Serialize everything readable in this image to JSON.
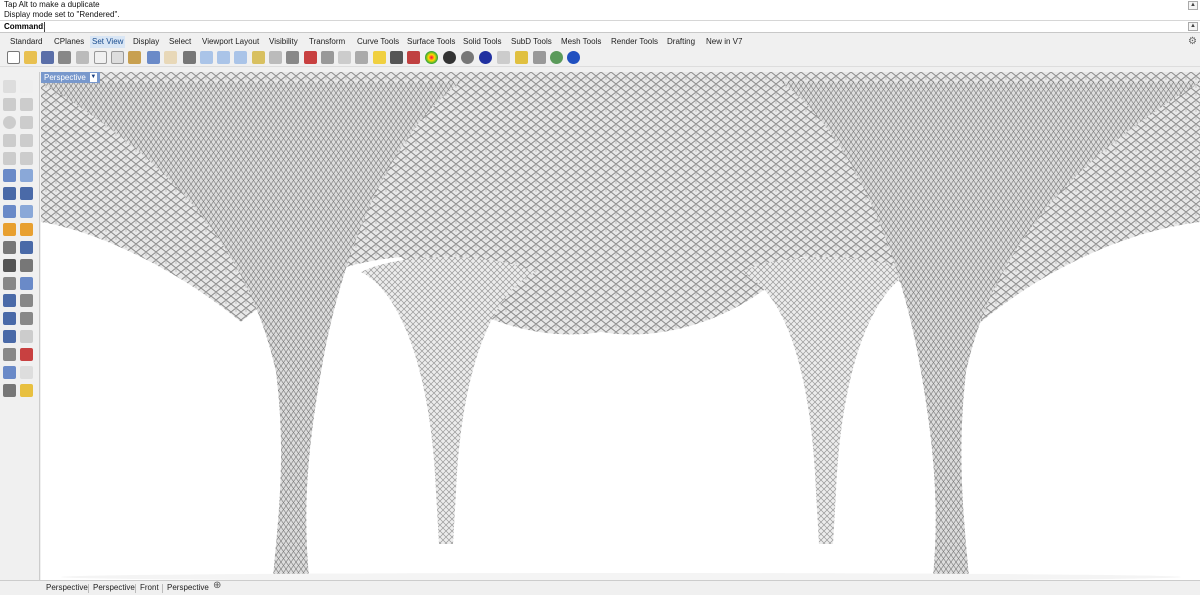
{
  "command": {
    "history": [
      "Tap Alt to make a duplicate",
      "Display mode set to \"Rendered\"."
    ],
    "prompt_label": "Command:",
    "input_value": ""
  },
  "tabs": [
    "Standard",
    "CPlanes",
    "Set View",
    "Display",
    "Select",
    "Viewport Layout",
    "Visibility",
    "Transform",
    "Curve Tools",
    "Surface Tools",
    "Solid Tools",
    "SubD Tools",
    "Mesh Tools",
    "Render Tools",
    "Drafting",
    "New in V7"
  ],
  "active_tab": "Set View",
  "viewport": {
    "label": "Perspective",
    "display_mode": "Rendered"
  },
  "bottom_tabs": [
    "Perspective",
    "Perspective",
    "Front",
    "Perspective"
  ],
  "colors": {
    "accent": "#7898cc",
    "active_tab_bg": "#d9e6f5",
    "background": "#f0f0f0",
    "viewport_bg": "#ffffff"
  },
  "icons": {
    "settings": "gear-icon",
    "add_viewport": "plus-icon",
    "viewport_menu": "chevron-down-icon"
  }
}
